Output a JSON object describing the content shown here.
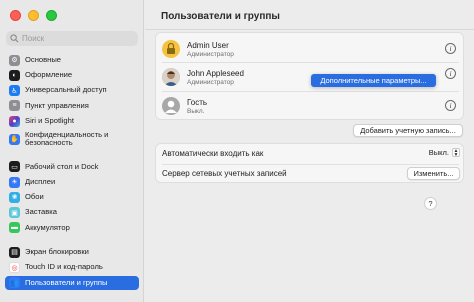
{
  "window": {
    "title": "Пользователи и группы"
  },
  "search": {
    "placeholder": "Поиск"
  },
  "sidebar": {
    "items": [
      {
        "label": "Основные",
        "icon": "gear-icon",
        "color": "#8e8e93"
      },
      {
        "label": "Оформление",
        "icon": "appearance-icon",
        "color": "#1c1c1e"
      },
      {
        "label": "Универсальный доступ",
        "icon": "accessibility-icon",
        "color": "#1e7cf2"
      },
      {
        "label": "Пункт управления",
        "icon": "control-center-icon",
        "color": "#8e8e93"
      },
      {
        "label": "Siri и Spotlight",
        "icon": "siri-icon",
        "color": "#5b3cc4"
      },
      {
        "label": "Конфиденциальность и безопасность",
        "icon": "hand-icon",
        "color": "#3478f6"
      },
      {
        "label": "Рабочий стол и Dock",
        "icon": "dock-icon",
        "color": "#1c1c1e"
      },
      {
        "label": "Дисплеи",
        "icon": "display-icon",
        "color": "#3478f6"
      },
      {
        "label": "Обои",
        "icon": "wallpaper-icon",
        "color": "#32ade6"
      },
      {
        "label": "Заставка",
        "icon": "screensaver-icon",
        "color": "#5ac8d8"
      },
      {
        "label": "Аккумулятор",
        "icon": "battery-icon",
        "color": "#34c759"
      },
      {
        "label": "Экран блокировки",
        "icon": "lock-screen-icon",
        "color": "#1c1c1e"
      },
      {
        "label": "Touch ID и код-пароль",
        "icon": "fingerprint-icon",
        "color": "#ff3b30"
      },
      {
        "label": "Пользователи и группы",
        "icon": "users-icon",
        "color": "#3478f6"
      }
    ]
  },
  "main": {
    "title": "Пользователи и группы",
    "users": [
      {
        "name": "Admin User",
        "role": "Администратор"
      },
      {
        "name": "John Appleseed",
        "role": "Администратор"
      },
      {
        "name": "Гость",
        "role": "Выкл."
      }
    ],
    "dropdown_label": "Дополнительные параметры...",
    "add_account_label": "Добавить учетную запись...",
    "auto_login_label": "Автоматически входить как",
    "auto_login_value": "Выкл.",
    "network_server_label": "Сервер сетевых учетных записей",
    "change_button_label": "Изменить...",
    "help_label": "?",
    "info_glyph": "i"
  },
  "colors": {
    "accent": "#2a6de0",
    "close": "#fe5f57",
    "minimize": "#febc2e",
    "maximize": "#28c840"
  }
}
